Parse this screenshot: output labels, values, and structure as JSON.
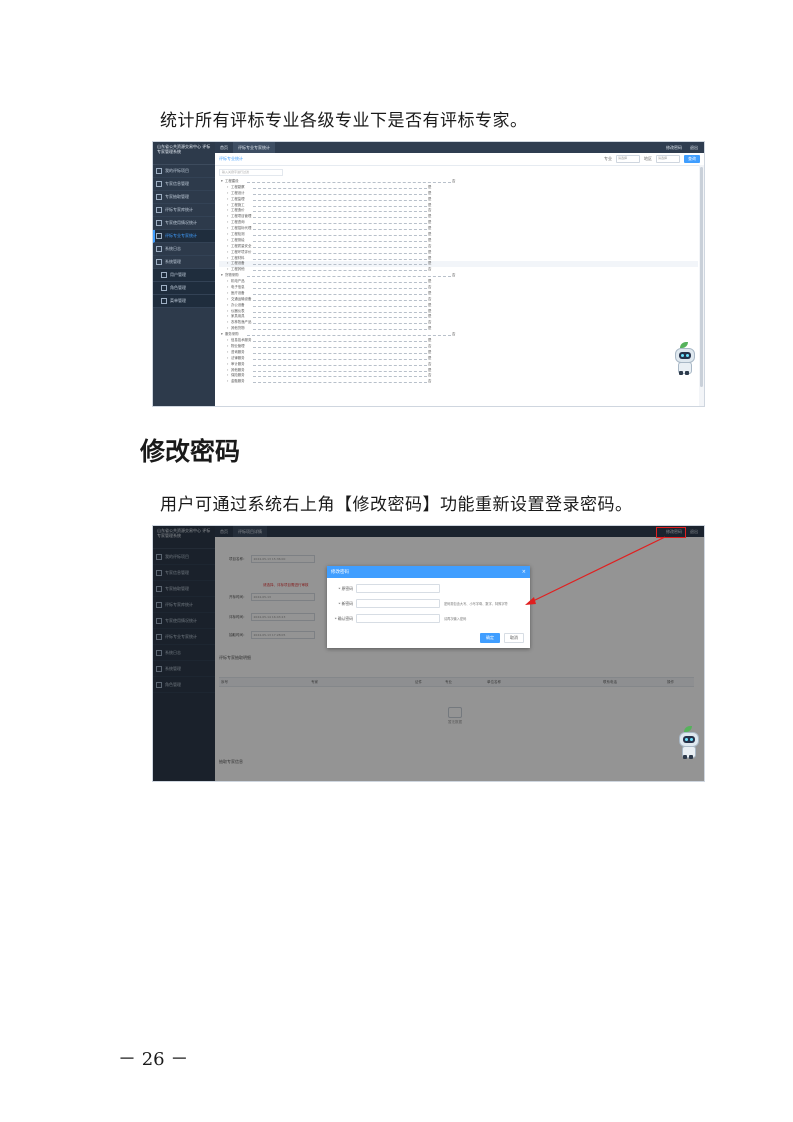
{
  "doc": {
    "para1": "统计所有评标专业各级专业下是否有评标专家。",
    "heading": "修改密码",
    "para2": "用户可通过系统右上角【修改密码】功能重新设置登录密码。",
    "page_number": "－ 26 －"
  },
  "shot1": {
    "brand": "山东省公共资源交易中心 评标专家管理系统",
    "menu": [
      {
        "label": "我的评标项目"
      },
      {
        "label": "专家信息管理"
      },
      {
        "label": "专家抽取管理"
      },
      {
        "label": "评标专家库统计"
      },
      {
        "label": "专家使用情况统计"
      },
      {
        "label": "评标专业专家统计"
      },
      {
        "label": "系统日志"
      },
      {
        "label": "系统管理"
      }
    ],
    "submenu": [
      {
        "label": "用户管理"
      },
      {
        "label": "角色管理"
      },
      {
        "label": "菜单管理"
      }
    ],
    "tabs": [
      {
        "label": "首页"
      },
      {
        "label": "评标专业专家统计"
      }
    ],
    "topright": [
      {
        "label": "修改密码"
      },
      {
        "label": "退出"
      }
    ],
    "toolbar_title": "评标专业统计",
    "filter_label1": "专业",
    "filter_label2": "地区",
    "filter_placeholder": "请选择",
    "search_button": "查询",
    "search_placeholder": "输入关键字进行过滤",
    "tree": [
      {
        "label": "工程建设",
        "val": "否",
        "lvl": 0,
        "hl": false
      },
      {
        "label": "工程勘察",
        "val": "是",
        "lvl": 1,
        "hl": false
      },
      {
        "label": "工程设计",
        "val": "是",
        "lvl": 1,
        "hl": false
      },
      {
        "label": "工程监理",
        "val": "是",
        "lvl": 1,
        "hl": false
      },
      {
        "label": "工程施工",
        "val": "是",
        "lvl": 1,
        "hl": false
      },
      {
        "label": "工程造价",
        "val": "否",
        "lvl": 1,
        "hl": false
      },
      {
        "label": "工程项目管理",
        "val": "是",
        "lvl": 1,
        "hl": false
      },
      {
        "label": "工程咨询",
        "val": "是",
        "lvl": 1,
        "hl": false
      },
      {
        "label": "工程招标代理",
        "val": "是",
        "lvl": 1,
        "hl": false
      },
      {
        "label": "工程检测",
        "val": "是",
        "lvl": 1,
        "hl": false
      },
      {
        "label": "工程测绘",
        "val": "是",
        "lvl": 1,
        "hl": false
      },
      {
        "label": "工程质量安全",
        "val": "否",
        "lvl": 1,
        "hl": false
      },
      {
        "label": "工程环境评价",
        "val": "是",
        "lvl": 1,
        "hl": false
      },
      {
        "label": "工程材料",
        "val": "是",
        "lvl": 1,
        "hl": false
      },
      {
        "label": "工程设备",
        "val": "是",
        "lvl": 1,
        "hl": true
      },
      {
        "label": "工程其他",
        "val": "否",
        "lvl": 1,
        "hl": false
      },
      {
        "label": "货物采购",
        "val": "否",
        "lvl": 0,
        "hl": false
      },
      {
        "label": "机电产品",
        "val": "是",
        "lvl": 1,
        "hl": false
      },
      {
        "label": "电子信息",
        "val": "否",
        "lvl": 1,
        "hl": false
      },
      {
        "label": "医疗设备",
        "val": "是",
        "lvl": 1,
        "hl": false
      },
      {
        "label": "交通运输设备",
        "val": "否",
        "lvl": 1,
        "hl": false
      },
      {
        "label": "办公设备",
        "val": "是",
        "lvl": 1,
        "hl": false
      },
      {
        "label": "仪器仪表",
        "val": "是",
        "lvl": 1,
        "hl": false
      },
      {
        "label": "家具用具",
        "val": "是",
        "lvl": 1,
        "hl": false
      },
      {
        "label": "农林牧渔产品",
        "val": "否",
        "lvl": 1,
        "hl": false
      },
      {
        "label": "其他货物",
        "val": "是",
        "lvl": 1,
        "hl": false
      },
      {
        "label": "服务采购",
        "val": "否",
        "lvl": 0,
        "hl": false
      },
      {
        "label": "信息技术服务",
        "val": "是",
        "lvl": 1,
        "hl": false
      },
      {
        "label": "物业管理",
        "val": "否",
        "lvl": 1,
        "hl": false
      },
      {
        "label": "咨询服务",
        "val": "是",
        "lvl": 1,
        "hl": false
      },
      {
        "label": "法律服务",
        "val": "是",
        "lvl": 1,
        "hl": false
      },
      {
        "label": "审计服务",
        "val": "否",
        "lvl": 1,
        "hl": false
      },
      {
        "label": "其他服务",
        "val": "是",
        "lvl": 1,
        "hl": false
      },
      {
        "label": "保险服务",
        "val": "否",
        "lvl": 1,
        "hl": false
      },
      {
        "label": "金融服务",
        "val": "否",
        "lvl": 1,
        "hl": false
      }
    ]
  },
  "shot2": {
    "brand": "山东省公共资源交易中心 评标专家管理系统",
    "menu": [
      {
        "label": "我的评标项目"
      },
      {
        "label": "专家信息管理"
      },
      {
        "label": "专家抽取管理"
      },
      {
        "label": "评标专家库统计"
      },
      {
        "label": "专家使用情况统计"
      },
      {
        "label": "评标专业专家统计"
      },
      {
        "label": "系统日志"
      },
      {
        "label": "系统管理"
      },
      {
        "label": "角色管理"
      }
    ],
    "tabs": [
      {
        "label": "首页"
      },
      {
        "label": "评标项目详情"
      }
    ],
    "topright": [
      {
        "label": "修改密码"
      },
      {
        "label": "退出"
      }
    ],
    "bg_rows": [
      {
        "label": "项目名称：",
        "value": "2024-05-13 15:36:00"
      },
      {
        "label": "开标时间：",
        "value": "2024-05-13"
      },
      {
        "label": "评标时间：",
        "value": "2024-05-14 16:43:23"
      },
      {
        "label": "抽取时间：",
        "value": "2024-05-13 17:28:05"
      }
    ],
    "bg_warning": "请选择、评标项目需进行审核",
    "section1": "评标专家抽取明细",
    "section2": "抽取专家信息",
    "table_headers": [
      {
        "label": "序号"
      },
      {
        "label": "专家"
      },
      {
        "label": "证件"
      },
      {
        "label": "专业"
      },
      {
        "label": "单位名称"
      },
      {
        "label": "联系电话"
      },
      {
        "label": "操作"
      }
    ],
    "empty_text": "暂无数据",
    "dialog": {
      "title": "修改密码",
      "close": "×",
      "fields": [
        {
          "label": "* 原密码",
          "hint": ""
        },
        {
          "label": "* 新密码",
          "hint": "密码需包含大写、小写字母、数字、特殊字符"
        },
        {
          "label": "* 确认密码",
          "hint": "请再次输入密码"
        }
      ],
      "confirm": "确定",
      "cancel": "取消"
    }
  },
  "colors": {
    "accent": "#409eff",
    "sidebar": "#2d3a4b",
    "highlight": "#e02020"
  }
}
